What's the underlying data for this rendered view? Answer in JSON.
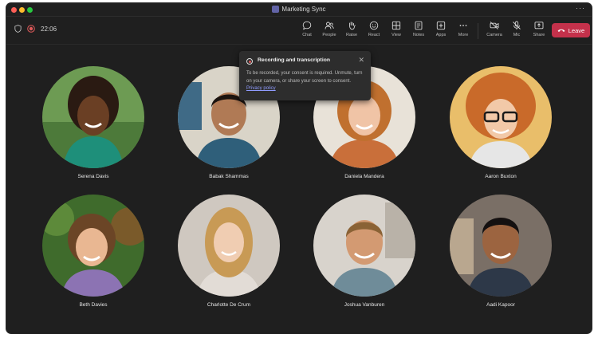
{
  "window": {
    "title": "Marketing Sync"
  },
  "call": {
    "timer": "22:06"
  },
  "toolbar": {
    "chat": "Chat",
    "people": "People",
    "raise": "Raise",
    "react": "React",
    "view": "View",
    "notes": "Notes",
    "apps": "Apps",
    "more": "More",
    "camera": "Camera",
    "mic": "Mic",
    "share": "Share",
    "leave": "Leave"
  },
  "banner": {
    "title": "Recording and transcription",
    "body": "To be recorded, your consent is required. Unmute, turn on your camera, or share your screen to consent.",
    "link": "Privacy policy"
  },
  "participants": [
    {
      "name": "Serena Davis"
    },
    {
      "name": "Babak Shammas"
    },
    {
      "name": "Daniela Mandera"
    },
    {
      "name": "Aaron Buxton"
    },
    {
      "name": "Beth Davies"
    },
    {
      "name": "Charlotte De Crum"
    },
    {
      "name": "Joshua Vanburen"
    },
    {
      "name": "Aadi Kapoor"
    }
  ],
  "colors": {
    "background": "#1f1f1f",
    "leave": "#c4314b",
    "link": "#8f9bff",
    "recording": "#e05a5a"
  }
}
